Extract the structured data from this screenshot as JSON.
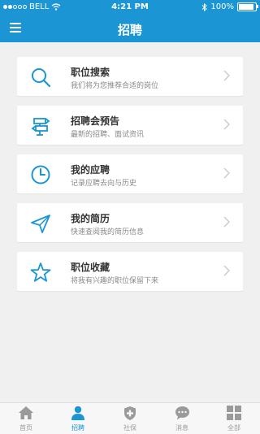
{
  "status": {
    "carrier": "BELL",
    "time": "4:21 PM",
    "battery": "100%",
    "battery_level": 1.0
  },
  "header": {
    "title": "招聘"
  },
  "menu_items": [
    {
      "title": "职位搜索",
      "subtitle": "我们将为您推荐合适的岗位",
      "icon": "search-icon"
    },
    {
      "title": "招聘会预告",
      "subtitle": "最新的招聘、面试资讯",
      "icon": "signpost-icon"
    },
    {
      "title": "我的应聘",
      "subtitle": "记录应聘去向与历史",
      "icon": "clock-icon"
    },
    {
      "title": "我的简历",
      "subtitle": "快速查阅我的简历信息",
      "icon": "paper-plane-icon"
    },
    {
      "title": "职位收藏",
      "subtitle": "将我有兴趣的职位保留下来",
      "icon": "star-icon"
    }
  ],
  "tabbar": [
    {
      "label": "首页",
      "icon": "home-icon"
    },
    {
      "label": "招聘",
      "icon": "person-icon",
      "active": true
    },
    {
      "label": "社保",
      "icon": "shield-plus-icon"
    },
    {
      "label": "消息",
      "icon": "chat-icon"
    },
    {
      "label": "全部",
      "icon": "grid-icon"
    }
  ],
  "colors": {
    "accent": "#1c95d4",
    "background": "#f0f0f0",
    "tab_inactive": "#9a9a9a"
  }
}
